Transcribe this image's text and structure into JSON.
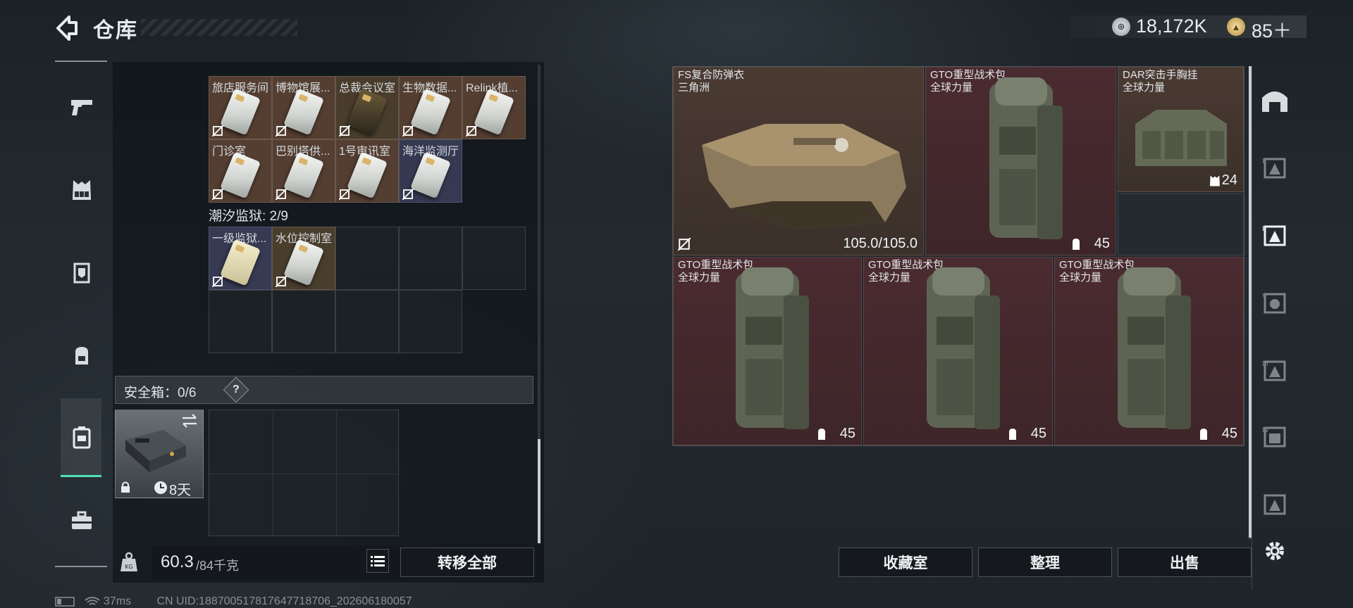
{
  "header": {
    "title": "仓库",
    "currency_value": "18,172K",
    "coin_icon": "silver-coin-icon",
    "points_value": "85＋",
    "points_icon": "gold-badge-icon"
  },
  "left_nav": {
    "items": [
      {
        "name": "nav-weapons",
        "icon": "pistol-icon"
      },
      {
        "name": "nav-chest-rig",
        "icon": "vest-icon"
      },
      {
        "name": "nav-armor",
        "icon": "armor-icon"
      },
      {
        "name": "nav-backpack",
        "icon": "backpack-icon"
      },
      {
        "name": "nav-safe-box",
        "icon": "safe-box-icon",
        "active": true
      },
      {
        "name": "nav-toolbox",
        "icon": "toolbox-icon"
      }
    ]
  },
  "keys_top": {
    "row1": [
      {
        "label": "旅店服务间",
        "tone": "brown"
      },
      {
        "label": "博物馆展...",
        "tone": "brown"
      },
      {
        "label": "总裁会议室",
        "tone": "brown2",
        "dark": true
      },
      {
        "label": "生物数据...",
        "tone": "brown"
      },
      {
        "label": "Relink植...",
        "tone": "brown"
      }
    ],
    "row2": [
      {
        "label": "门诊室",
        "tone": "brown"
      },
      {
        "label": "巴别塔供...",
        "tone": "brown"
      },
      {
        "label": "1号审讯室",
        "tone": "brown"
      },
      {
        "label": "海洋监测厅",
        "tone": "blue"
      }
    ]
  },
  "prison_section": {
    "label": "潮汐监狱: 2/9",
    "keys": [
      {
        "label": "一级监狱...",
        "tone": "blue",
        "yellow": true
      },
      {
        "label": "水位控制室",
        "tone": "brown2"
      }
    ]
  },
  "safe_box": {
    "label": "安全箱：0/6",
    "help": "?",
    "timer": "8天"
  },
  "weight": {
    "current": "60.3",
    "max": "/84千克"
  },
  "buttons": {
    "transfer_all": "转移全部",
    "collection": "收藏室",
    "organize": "整理",
    "sell": "出售"
  },
  "items": [
    {
      "name": "FS复合防弹衣",
      "sub": "三角洲",
      "value": "105.0/105.0",
      "tone": "brown"
    },
    {
      "name": "GTO重型战术包",
      "sub": "全球力量",
      "value": "45",
      "tone": "red"
    },
    {
      "name": "DAR突击手胸挂",
      "sub": "全球力量",
      "value": "24",
      "tone": "brown"
    },
    {
      "name": "GTO重型战术包",
      "sub": "全球力量",
      "value": "45",
      "tone": "red"
    },
    {
      "name": "GTO重型战术包",
      "sub": "全球力量",
      "value": "45",
      "tone": "red"
    },
    {
      "name": "GTO重型战术包",
      "sub": "全球力量",
      "value": "45",
      "tone": "red"
    }
  ],
  "status": {
    "ping": "37ms",
    "uid": "CN UID:188700517817647718706_202606180057"
  }
}
